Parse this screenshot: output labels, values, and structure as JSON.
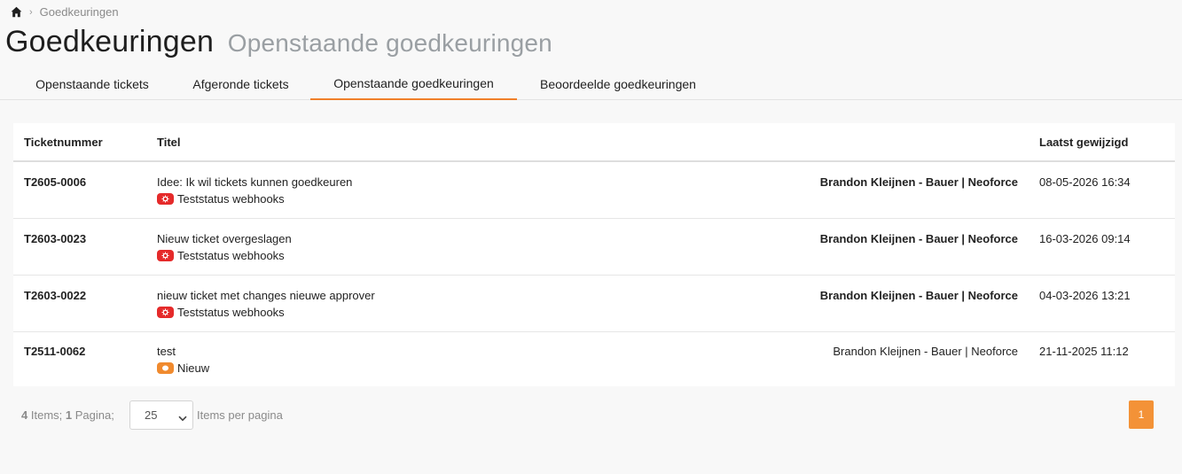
{
  "breadcrumb": {
    "home_icon": "home-icon",
    "current": "Goedkeuringen"
  },
  "header": {
    "title": "Goedkeuringen",
    "subtitle": "Openstaande goedkeuringen"
  },
  "tabs": [
    {
      "label": "Openstaande tickets",
      "active": false
    },
    {
      "label": "Afgeronde tickets",
      "active": false
    },
    {
      "label": "Openstaande goedkeuringen",
      "active": true
    },
    {
      "label": "Beoordeelde goedkeuringen",
      "active": false
    }
  ],
  "table": {
    "columns": {
      "number": "Ticketnummer",
      "title": "Titel",
      "modified": "Laatst gewijzigd"
    },
    "rows": [
      {
        "number": "T2605-0006",
        "title": "Idee: Ik wil tickets kunnen goedkeuren",
        "status": "Teststatus webhooks",
        "status_color": "#e52a2a",
        "user": "Brandon Kleijnen - Bauer | Neoforce",
        "user_bold": true,
        "modified": "08-05-2026 16:34"
      },
      {
        "number": "T2603-0023",
        "title": "Nieuw ticket overgeslagen",
        "status": "Teststatus webhooks",
        "status_color": "#e52a2a",
        "user": "Brandon Kleijnen - Bauer | Neoforce",
        "user_bold": true,
        "modified": "16-03-2026 09:14"
      },
      {
        "number": "T2603-0022",
        "title": "nieuw ticket met changes nieuwe approver",
        "status": "Teststatus webhooks",
        "status_color": "#e52a2a",
        "user": "Brandon Kleijnen - Bauer | Neoforce",
        "user_bold": true,
        "modified": "04-03-2026 13:21"
      },
      {
        "number": "T2511-0062",
        "title": "test",
        "status": "Nieuw",
        "status_color": "#f08a2e",
        "user": "Brandon Kleijnen - Bauer | Neoforce",
        "user_bold": false,
        "modified": "21-11-2025 11:12"
      }
    ]
  },
  "footer": {
    "items_count": "4",
    "items_label": "Items;",
    "pages_count": "1",
    "pages_label": "Pagina;",
    "page_size": "25",
    "per_page_label": "Items per pagina",
    "current_page": "1",
    "accent_color": "#f39237"
  }
}
